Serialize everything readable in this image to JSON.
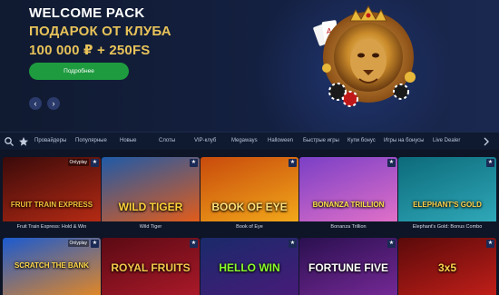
{
  "hero": {
    "title": "WELCOME PACK",
    "line1": "ПОДАРОК ОТ КЛУБА",
    "line2": "100 000 ₽ + 250FS",
    "button_label": "Подробнее",
    "prev_icon": "‹",
    "next_icon": "›"
  },
  "nav": {
    "search_icon": "search-icon",
    "favorites_icon": "star-icon",
    "items": [
      "Провайдеры",
      "Популярные",
      "Новые",
      "Слоты",
      "VIP-клуб",
      "Megaways",
      "Halloween",
      "Быстрые игры",
      "Купи бонус",
      "Игры на бонусы",
      "Live Dealer"
    ]
  },
  "games": [
    {
      "caption": "Fruit Train Express: Hold & Win",
      "provider": "Onlyplay",
      "logo": "FRUIT TRAIN EXPRESS",
      "colors": [
        "#3a0a0a",
        "#b52a14"
      ],
      "logo_color": "#f4c13a"
    },
    {
      "caption": "Wild Tiger",
      "provider": "",
      "logo": "WILD TIGER",
      "colors": [
        "#1e5aa8",
        "#e25c1a"
      ],
      "logo_color": "#ffd23a"
    },
    {
      "caption": "Book of Eye",
      "provider": "",
      "logo": "BOOK OF EYE",
      "colors": [
        "#c84a0c",
        "#f2a81a"
      ],
      "logo_color": "#ffe07a"
    },
    {
      "caption": "Bonanza Trillion",
      "provider": "",
      "logo": "BONANZA TRILLION",
      "colors": [
        "#7a3fc6",
        "#e070c8"
      ],
      "logo_color": "#ffe14a"
    },
    {
      "caption": "Elephant's Gold: Bonus Combo",
      "provider": "",
      "logo": "ELEPHANT'S GOLD",
      "colors": [
        "#0c6a7a",
        "#2fa8b8"
      ],
      "logo_color": "#ffd24a"
    },
    {
      "caption": "",
      "provider": "Onlyplay",
      "logo": "SCRATCH THE BANK",
      "colors": [
        "#1a5ad0",
        "#f08a1a"
      ],
      "logo_color": "#ffd84a"
    },
    {
      "caption": "",
      "provider": "",
      "logo": "ROYAL FRUITS",
      "colors": [
        "#5a0a14",
        "#b01a2a"
      ],
      "logo_color": "#f5c84a"
    },
    {
      "caption": "",
      "provider": "",
      "logo": "HELLO WIN",
      "colors": [
        "#1a2a6a",
        "#4a1a7a"
      ],
      "logo_color": "#8aff2a"
    },
    {
      "caption": "",
      "provider": "",
      "logo": "FORTUNE FIVE",
      "colors": [
        "#2a1050",
        "#7a2a9a"
      ],
      "logo_color": "#ffffff"
    },
    {
      "caption": "",
      "provider": "",
      "logo": "3x5",
      "colors": [
        "#5a0a0a",
        "#c8201a"
      ],
      "logo_color": "#ffd24a"
    }
  ]
}
